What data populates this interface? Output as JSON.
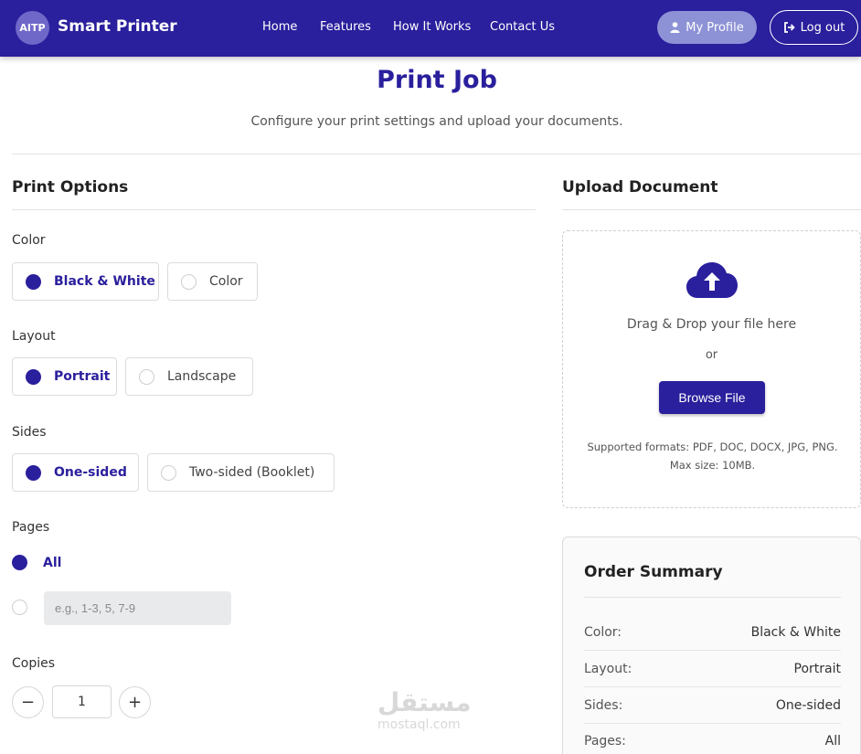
{
  "navbar": {
    "logo_text": "AITP",
    "brand": "Smart Printer",
    "links": [
      "Home",
      "Features",
      "How It Works",
      "Contact Us"
    ],
    "profile_label": "My Profile",
    "logout_label": "Log out"
  },
  "header": {
    "title": "Print Job",
    "subtitle": "Configure your print settings and upload your documents."
  },
  "print_options": {
    "title": "Print Options",
    "color": {
      "label": "Color",
      "options": [
        "Black & White",
        "Color"
      ],
      "selected": "Black & White"
    },
    "layout": {
      "label": "Layout",
      "options": [
        "Portrait",
        "Landscape"
      ],
      "selected": "Portrait"
    },
    "sides": {
      "label": "Sides",
      "options": [
        "One-sided",
        "Two-sided (Booklet)"
      ],
      "selected": "One-sided"
    },
    "pages": {
      "label": "Pages",
      "all_label": "All",
      "range_placeholder": "e.g., 1-3, 5, 7-9"
    },
    "copies": {
      "label": "Copies",
      "value": "1",
      "minus": "−",
      "plus": "+"
    }
  },
  "upload": {
    "title": "Upload Document",
    "drag_text": "Drag & Drop your file here",
    "or_text": "or",
    "browse_label": "Browse File",
    "formats_text": "Supported formats: PDF, DOC, DOCX, JPG, PNG. Max size: 10MB."
  },
  "summary": {
    "title": "Order Summary",
    "rows": [
      {
        "key": "Color:",
        "value": "Black & White"
      },
      {
        "key": "Layout:",
        "value": "Portrait"
      },
      {
        "key": "Sides:",
        "value": "One-sided"
      },
      {
        "key": "Pages:",
        "value": "All"
      }
    ]
  },
  "watermark": {
    "main": "مستقل",
    "sub": "mostaql.com"
  },
  "colors": {
    "primary": "#2a1f9c",
    "profile_button": "#8d92d6",
    "input_bg": "#e9eaeb"
  },
  "icons": [
    "user-icon",
    "logout-icon",
    "cloud-upload-icon"
  ]
}
